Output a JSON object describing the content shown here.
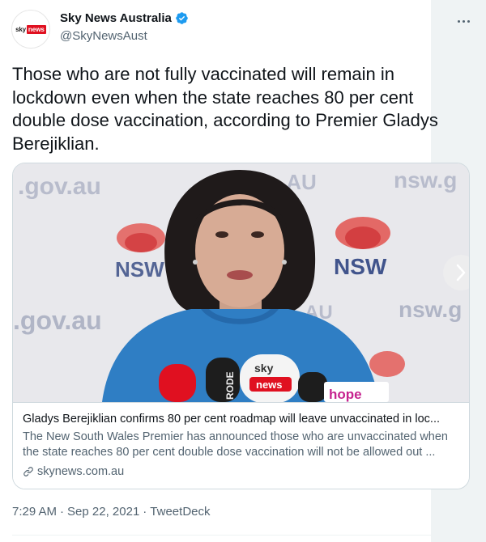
{
  "author": {
    "name": "Sky News Australia",
    "handle": "@SkyNewsAust",
    "avatar_logo": {
      "sky": "sky",
      "news": "news"
    }
  },
  "tweet": {
    "text": "Those who are not fully vaccinated will remain in lockdown even when the state reaches 80 per cent double dose vaccination, according to Premier Gladys Berejiklian."
  },
  "card": {
    "image_labels": {
      "gov_top": ".gov.au",
      "au_top": ".AU",
      "nsw_top": "nsw.g",
      "gov_mid": ".gov.au",
      "nsw_mid": "nsw.g",
      "au_mid": "AU",
      "nsw_logo_left": "NSW",
      "nsw_logo_right": "NSW",
      "mic_sky": "sky",
      "mic_news": "news",
      "mic_rode": "RODE",
      "hope": "hope"
    },
    "title": "Gladys Berejiklian confirms 80 per cent roadmap will leave unvaccinated in loc...",
    "description": "The New South Wales Premier has announced those who are unvaccinated when the state reaches 80 per cent double dose vaccination will not be allowed out ...",
    "domain": "skynews.com.au"
  },
  "meta": {
    "time": "7:29 AM",
    "sep1": "·",
    "date": "Sep 22, 2021",
    "sep2": "·",
    "source": "TweetDeck"
  },
  "icons": {
    "verified": "verified-badge-icon",
    "more": "more-options-icon",
    "link": "link-icon",
    "next": "chevron-right-icon"
  },
  "colors": {
    "verified": "#1d9bf0",
    "text_primary": "#0f1419",
    "text_secondary": "#536471",
    "border": "#cfd9de",
    "sky_red": "#e01020",
    "blazer_blue": "#2f7ec4"
  }
}
